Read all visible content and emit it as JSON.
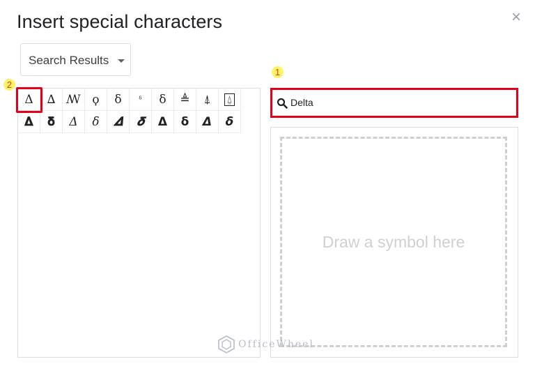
{
  "dialog": {
    "title": "Insert special characters",
    "close_glyph": "×"
  },
  "category": {
    "selected": "Search Results"
  },
  "annotations": {
    "search_step": "1",
    "cell_step": "2"
  },
  "search": {
    "value": "Delta",
    "icon": "search-icon"
  },
  "results": [
    {
      "glyph": "Δ",
      "style": "plain"
    },
    {
      "glyph": "∆",
      "style": "plain"
    },
    {
      "glyph": "ꟿ",
      "style": "plain"
    },
    {
      "glyph": "ϙ",
      "style": "plain"
    },
    {
      "glyph": "δ",
      "style": "plain"
    },
    {
      "glyph": "ᵟ",
      "style": "small"
    },
    {
      "glyph": "ẟ",
      "style": "plain"
    },
    {
      "glyph": "≜",
      "style": "plain"
    },
    {
      "glyph": "⍋",
      "style": "plain"
    },
    {
      "glyph": "⍙",
      "style": "boxed"
    },
    {
      "glyph": "𝚫",
      "style": "bold"
    },
    {
      "glyph": "𝛅",
      "style": "bold"
    },
    {
      "glyph": "𝛥",
      "style": "italic"
    },
    {
      "glyph": "𝛿",
      "style": "italic"
    },
    {
      "glyph": "𝜟",
      "style": "bolditalic"
    },
    {
      "glyph": "𝜹",
      "style": "bolditalic"
    },
    {
      "glyph": "𝝙",
      "style": "bold"
    },
    {
      "glyph": "𝝳",
      "style": "bold"
    },
    {
      "glyph": "𝞓",
      "style": "bolditalic"
    },
    {
      "glyph": "𝞭",
      "style": "bolditalic"
    }
  ],
  "draw": {
    "hint": "Draw a symbol here"
  },
  "watermark": {
    "text": "OfficeWheel"
  },
  "colors": {
    "highlight": "#e0001b",
    "badge": "#fff36a"
  }
}
